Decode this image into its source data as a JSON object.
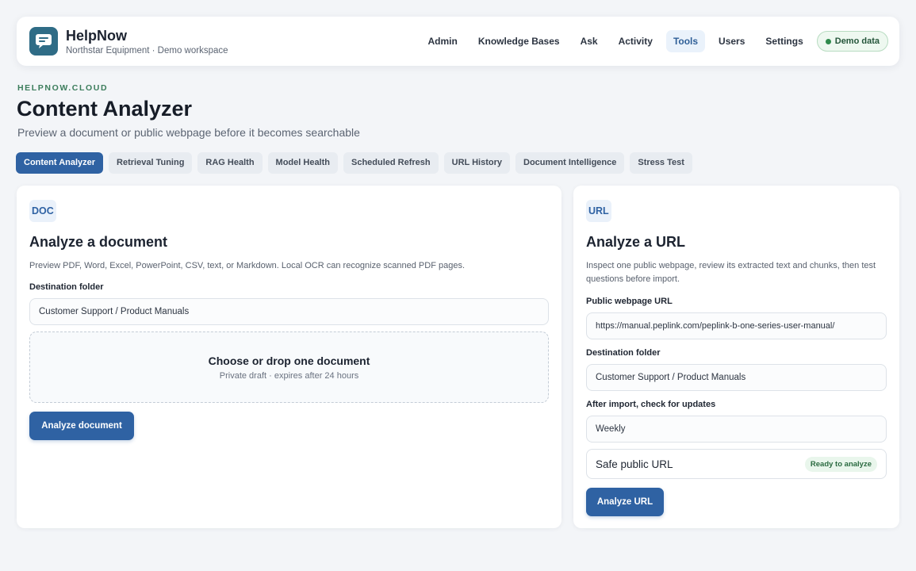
{
  "app": {
    "name": "HelpNow",
    "workspace": "Northstar Equipment · Demo workspace",
    "logo_icon": "chat-bubble-icon",
    "accent": "#2f62a3"
  },
  "nav": {
    "items": [
      {
        "label": "Admin",
        "active": false
      },
      {
        "label": "Knowledge Bases",
        "active": false
      },
      {
        "label": "Ask",
        "active": false
      },
      {
        "label": "Activity",
        "active": false
      },
      {
        "label": "Tools",
        "active": true
      },
      {
        "label": "Users",
        "active": false
      },
      {
        "label": "Settings",
        "active": false
      }
    ],
    "demo_label": "Demo data"
  },
  "page": {
    "eyebrow": "HELPNOW.CLOUD",
    "title": "Content Analyzer",
    "subtitle": "Preview a document or public webpage before it becomes searchable"
  },
  "tabs": [
    {
      "label": "Content Analyzer",
      "active": true
    },
    {
      "label": "Retrieval Tuning",
      "active": false
    },
    {
      "label": "RAG Health",
      "active": false
    },
    {
      "label": "Model Health",
      "active": false
    },
    {
      "label": "Scheduled Refresh",
      "active": false
    },
    {
      "label": "URL History",
      "active": false
    },
    {
      "label": "Document Intelligence",
      "active": false
    },
    {
      "label": "Stress Test",
      "active": false
    }
  ],
  "doc_card": {
    "badge": "DOC",
    "title": "Analyze a document",
    "description": "Preview PDF, Word, Excel, PowerPoint, CSV, text, or Markdown. Local OCR can recognize scanned PDF pages.",
    "folder_label": "Destination folder",
    "folder_value": "Customer Support / Product Manuals",
    "drop_title": "Choose or drop one document",
    "drop_sub": "Private draft · expires after 24 hours",
    "button": "Analyze document"
  },
  "url_card": {
    "badge": "URL",
    "title": "Analyze a URL",
    "description": "Inspect one public webpage, review its extracted text and chunks, then test questions before import.",
    "url_label": "Public webpage URL",
    "url_value": "https://manual.peplink.com/peplink-b-one-series-user-manual/",
    "folder_label": "Destination folder",
    "folder_value": "Customer Support / Product Manuals",
    "update_label": "After import, check for updates",
    "update_value": "Weekly",
    "safe_label": "Safe public URL",
    "safe_status": "Ready to analyze",
    "button": "Analyze URL"
  }
}
